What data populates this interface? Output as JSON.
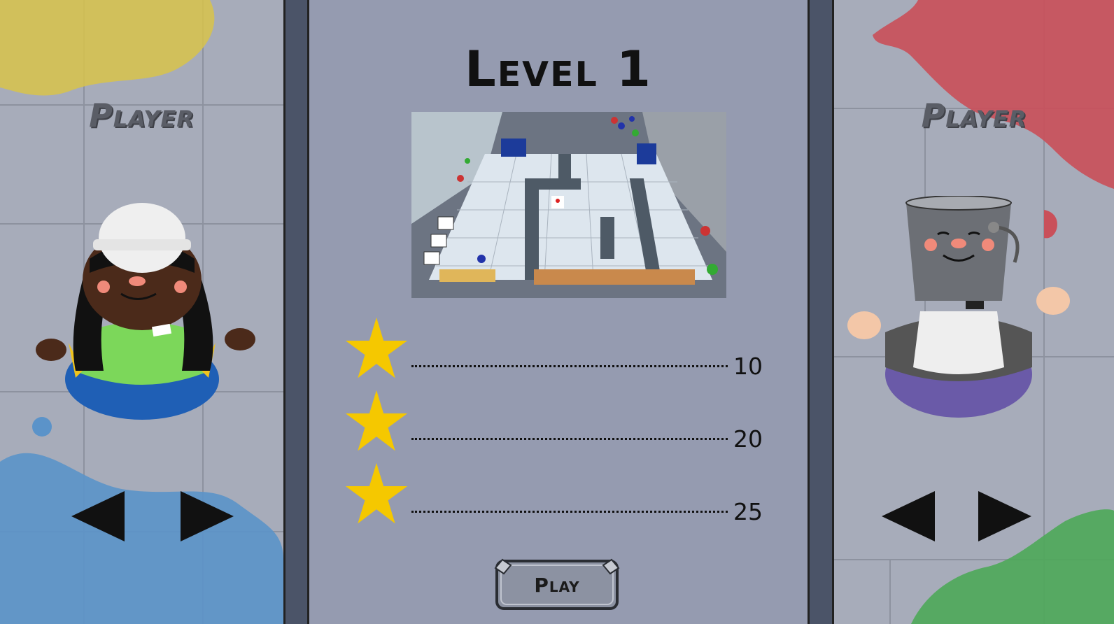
{
  "left_panel": {
    "label": "Player",
    "character": "construction-worker-character",
    "splash_colors": [
      "#d8c34a",
      "#5b93c9"
    ]
  },
  "right_panel": {
    "label": "Player",
    "character": "bucket-character",
    "splash_colors": [
      "#c9505a",
      "#4fa85a"
    ]
  },
  "level": {
    "title": "Level 1",
    "preview_icon": "level-preview-thumbnail"
  },
  "stars": [
    {
      "score": "10"
    },
    {
      "score": "20"
    },
    {
      "score": "25"
    }
  ],
  "play_button": {
    "label": "Play"
  },
  "colors": {
    "star": "#f5c800",
    "center_bg": "#959bb0",
    "divider": "#4b5468"
  },
  "icons": {
    "prev": "left-triangle-arrow-icon",
    "next": "right-triangle-arrow-icon",
    "star": "star-icon"
  }
}
